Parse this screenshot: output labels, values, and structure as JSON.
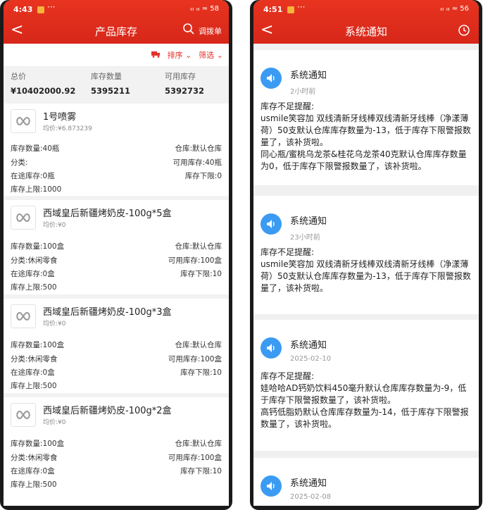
{
  "left": {
    "status": {
      "time": "4:43",
      "signal": "ᵢₗₗ ᵢₗₗ ≈ 58"
    },
    "nav": {
      "back": "<",
      "title": "产品库存",
      "transfer": "调拨单"
    },
    "sort": {
      "sort_label": "排序",
      "filter_label": "筛选"
    },
    "summary": {
      "total_label": "总价",
      "total_value": "¥10402000.92",
      "qty_label": "库存数量",
      "qty_value": "5395211",
      "avail_label": "可用库存",
      "avail_value": "5392732"
    },
    "products": [
      {
        "name": "1号喷雾",
        "price": "均价:¥6.873239",
        "r1l": "库存数量:40瓶",
        "r1r": "仓库:默认仓库",
        "r2l": "分类:",
        "r2r": "可用库存:40瓶",
        "r3l": "在途库存:0瓶",
        "r3r": "库存下限:0",
        "r4l": "库存上限:1000"
      },
      {
        "name": "西域皇后新疆烤奶皮-100g*5盒",
        "price": "均价:¥0",
        "r1l": "库存数量:100盒",
        "r1r": "仓库:默认仓库",
        "r2l": "分类:休闲零食",
        "r2r": "可用库存:100盒",
        "r3l": "在途库存:0盒",
        "r3r": "库存下限:10",
        "r4l": "库存上限:500"
      },
      {
        "name": "西域皇后新疆烤奶皮-100g*3盒",
        "price": "均价:¥0",
        "r1l": "库存数量:100盒",
        "r1r": "仓库:默认仓库",
        "r2l": "分类:休闲零食",
        "r2r": "可用库存:100盒",
        "r3l": "在途库存:0盒",
        "r3r": "库存下限:10",
        "r4l": "库存上限:500"
      },
      {
        "name": "西域皇后新疆烤奶皮-100g*2盒",
        "price": "均价:¥0",
        "r1l": "库存数量:100盒",
        "r1r": "仓库:默认仓库",
        "r2l": "分类:休闲零食",
        "r2r": "可用库存:100盒",
        "r3l": "在途库存:0盒",
        "r3r": "库存下限:10",
        "r4l": "库存上限:500"
      }
    ]
  },
  "right": {
    "status": {
      "time": "4:51",
      "signal": "ᵢₗₗ ᵢₗₗ ≈ 56"
    },
    "nav": {
      "back": "<",
      "title": "系统通知"
    },
    "notices": [
      {
        "title": "系统通知",
        "time": "2小时前",
        "body": "库存不足提醒:\nusmile笑容加 双线清新牙线棒双线清新牙线棒（净漾薄荷）50支默认仓库库存数量为-13，低于库存下限警报数量了，该补货啦。\n同心瓶/蜜桃乌龙茶&桂花乌龙茶40克默认仓库库存数量为0，低于库存下限警报数量了，该补货啦。"
      },
      {
        "title": "系统通知",
        "time": "23小时前",
        "body": "库存不足提醒:\nusmile笑容加 双线清新牙线棒双线清新牙线棒（净漾薄荷）50支默认仓库库存数量为-13，低于库存下限警报数量了，该补货啦。"
      },
      {
        "title": "系统通知",
        "time": "2025-02-10",
        "body": "库存不足提醒:\n娃哈哈AD钙奶饮料450毫升默认仓库库存数量为-9，低于库存下限警报数量了，该补货啦。\n高钙低脂奶默认仓库库存数量为-14，低于库存下限警报数量了，该补货啦。"
      },
      {
        "title": "系统通知",
        "time": "2025-02-08",
        "body": ""
      }
    ]
  },
  "colors": {
    "header": "#e3322c",
    "bell": "#3b9bf3"
  }
}
